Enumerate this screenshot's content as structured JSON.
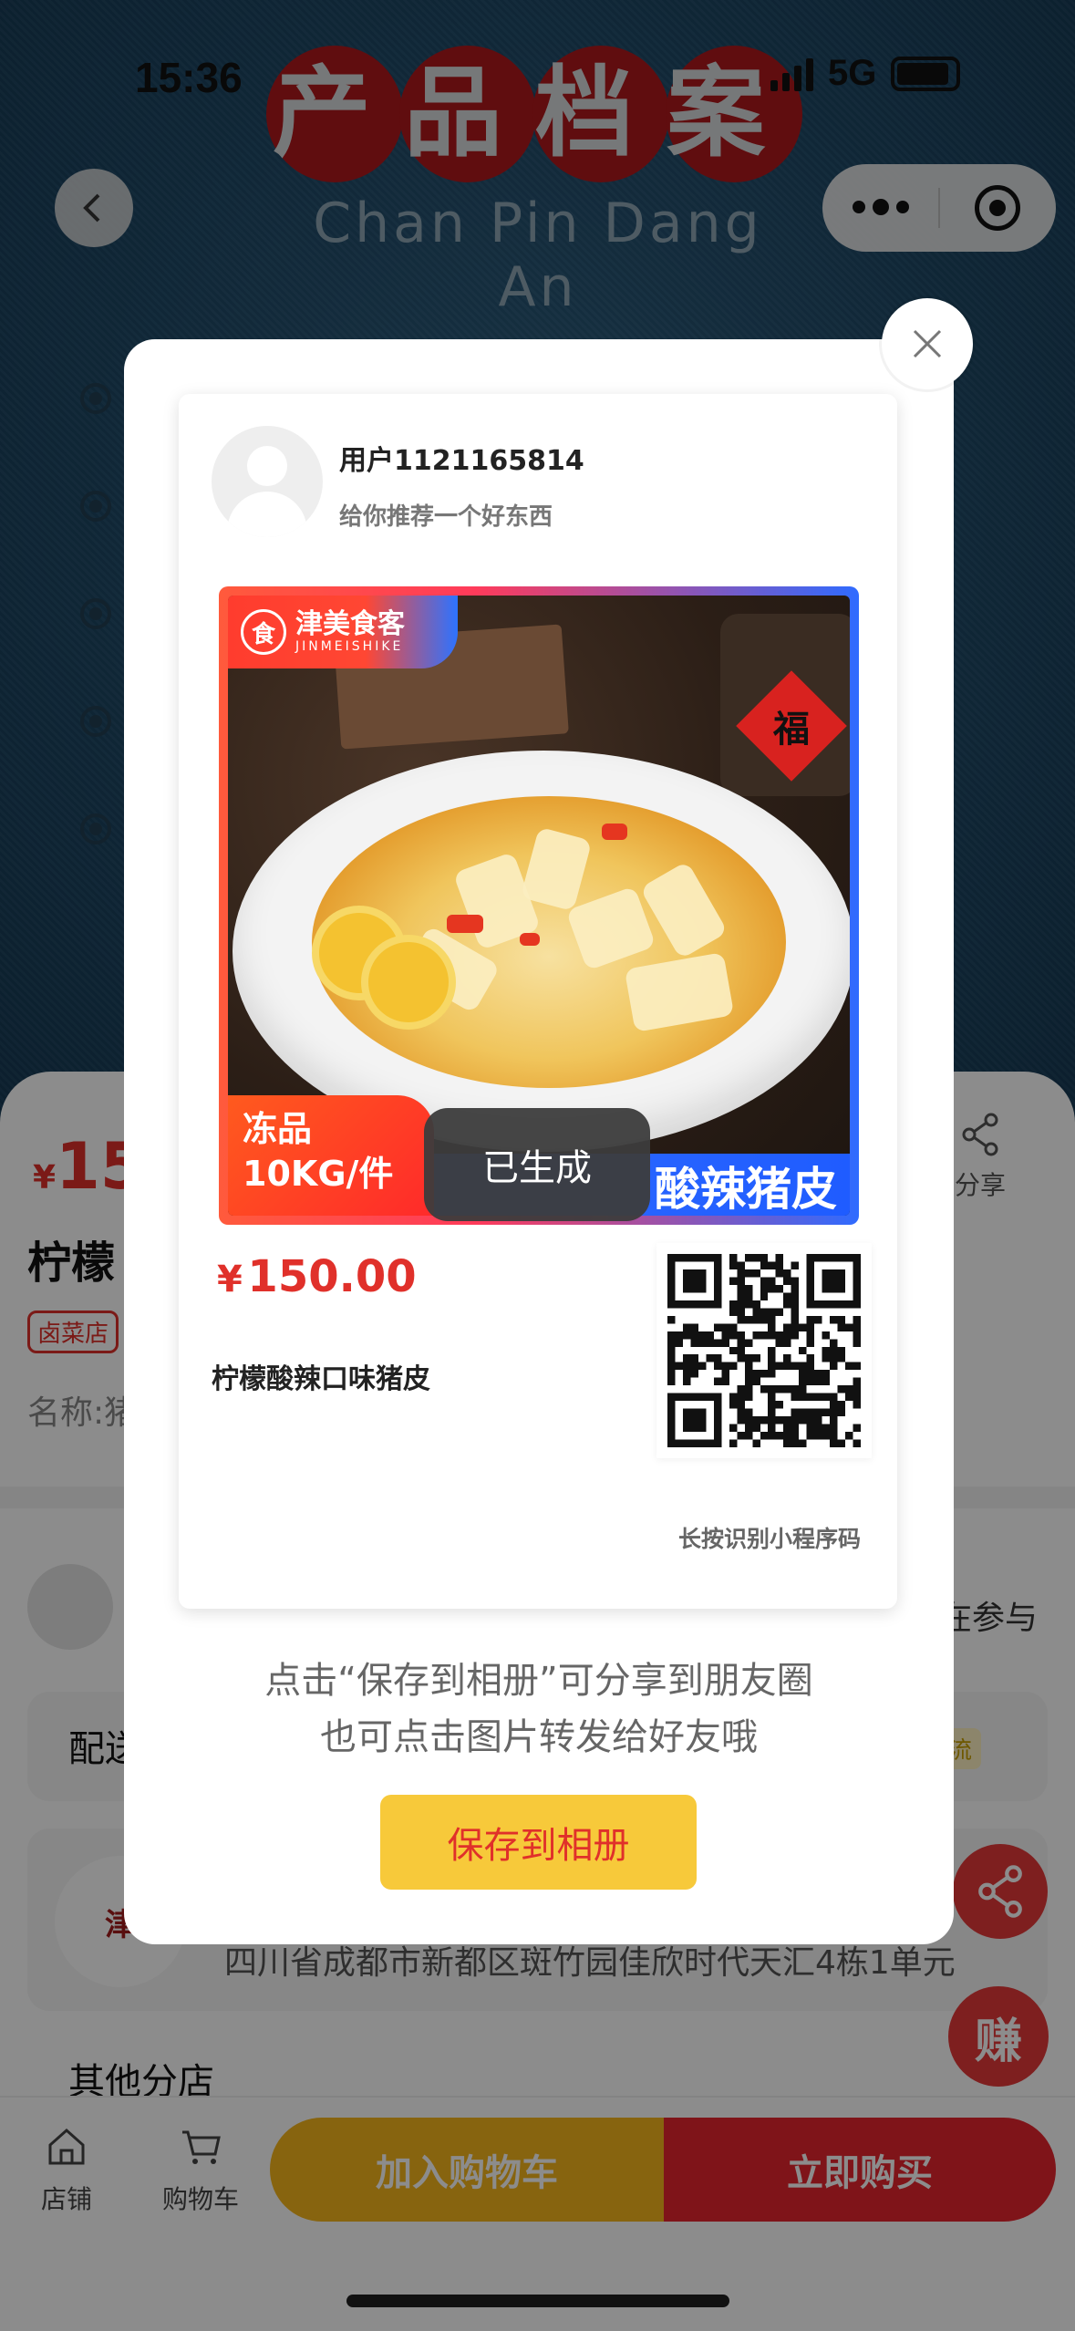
{
  "status_bar": {
    "time": "15:36",
    "network": "5G"
  },
  "header": {
    "title": "产品档案",
    "subtitle": "Chan Pin Dang An"
  },
  "product": {
    "price_currency": "¥",
    "price_partial": "15",
    "name_partial": "柠檬",
    "shop_tag": "卤菜店",
    "spec_partial": "名称:猪",
    "share_label": "分享"
  },
  "activity": {
    "joined_partial": "在参与"
  },
  "delivery": {
    "label_partial": "配送",
    "tag_partial": "流"
  },
  "store": {
    "logo_text": "津",
    "address": "四川省成都市新都区斑竹园佳欣时代天汇4栋1单元"
  },
  "branches": {
    "label": "其他分店"
  },
  "float_buttons": {
    "earn": "赚"
  },
  "bottom_nav": {
    "shop": "店铺",
    "cart": "购物车",
    "add_to_cart": "加入购物车",
    "buy_now": "立即购买"
  },
  "poster": {
    "user_name": "用户1121165814",
    "recommend_text": "给你推荐一个好东西",
    "brand_name": "津美食客",
    "brand_sub": "JINMEISHIKE",
    "brand_seal": "食",
    "fu_char": "福",
    "badge_line1": "冻品",
    "badge_line2": "10KG/件",
    "badge_product": "酸辣猪皮",
    "price_currency": "¥",
    "price": "150.00",
    "product_name": "柠檬酸辣口味猪皮",
    "qr_hint": "长按识别小程序码"
  },
  "modal": {
    "tip_line1": "点击“保存到相册”可分享到朋友圈",
    "tip_line2": "也可点击图片转发给好友哦",
    "save_button": "保存到相册"
  },
  "toast": {
    "text": "已生成"
  },
  "colors": {
    "accent_red": "#e0302a",
    "accent_yellow": "#f7c93a",
    "brand_blue": "#2f6bff"
  }
}
